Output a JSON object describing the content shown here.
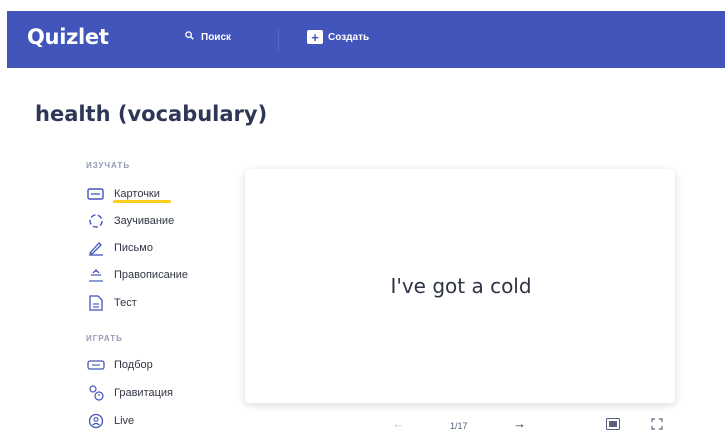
{
  "header": {
    "logo": "Quizlet",
    "search_label": "Поиск",
    "create_label": "Создать",
    "brand_color": "#4255bb"
  },
  "set": {
    "title": "health (vocabulary)"
  },
  "sidebar": {
    "study_label": "ИЗУЧАТЬ",
    "study_modes": [
      {
        "label": "Карточки",
        "icon": "cards-icon",
        "active": true
      },
      {
        "label": "Заучивание",
        "icon": "learn-icon"
      },
      {
        "label": "Письмо",
        "icon": "write-icon"
      },
      {
        "label": "Правописание",
        "icon": "spell-icon"
      },
      {
        "label": "Тест",
        "icon": "test-icon"
      }
    ],
    "play_label": "ИГРАТЬ",
    "play_modes": [
      {
        "label": "Подбор",
        "icon": "match-icon"
      },
      {
        "label": "Гравитация",
        "icon": "gravity-icon"
      },
      {
        "label": "Live",
        "icon": "live-icon"
      }
    ],
    "active_color": "#ffcd1f"
  },
  "card": {
    "term": "I've got a cold"
  },
  "controls": {
    "counter": "1/17"
  }
}
